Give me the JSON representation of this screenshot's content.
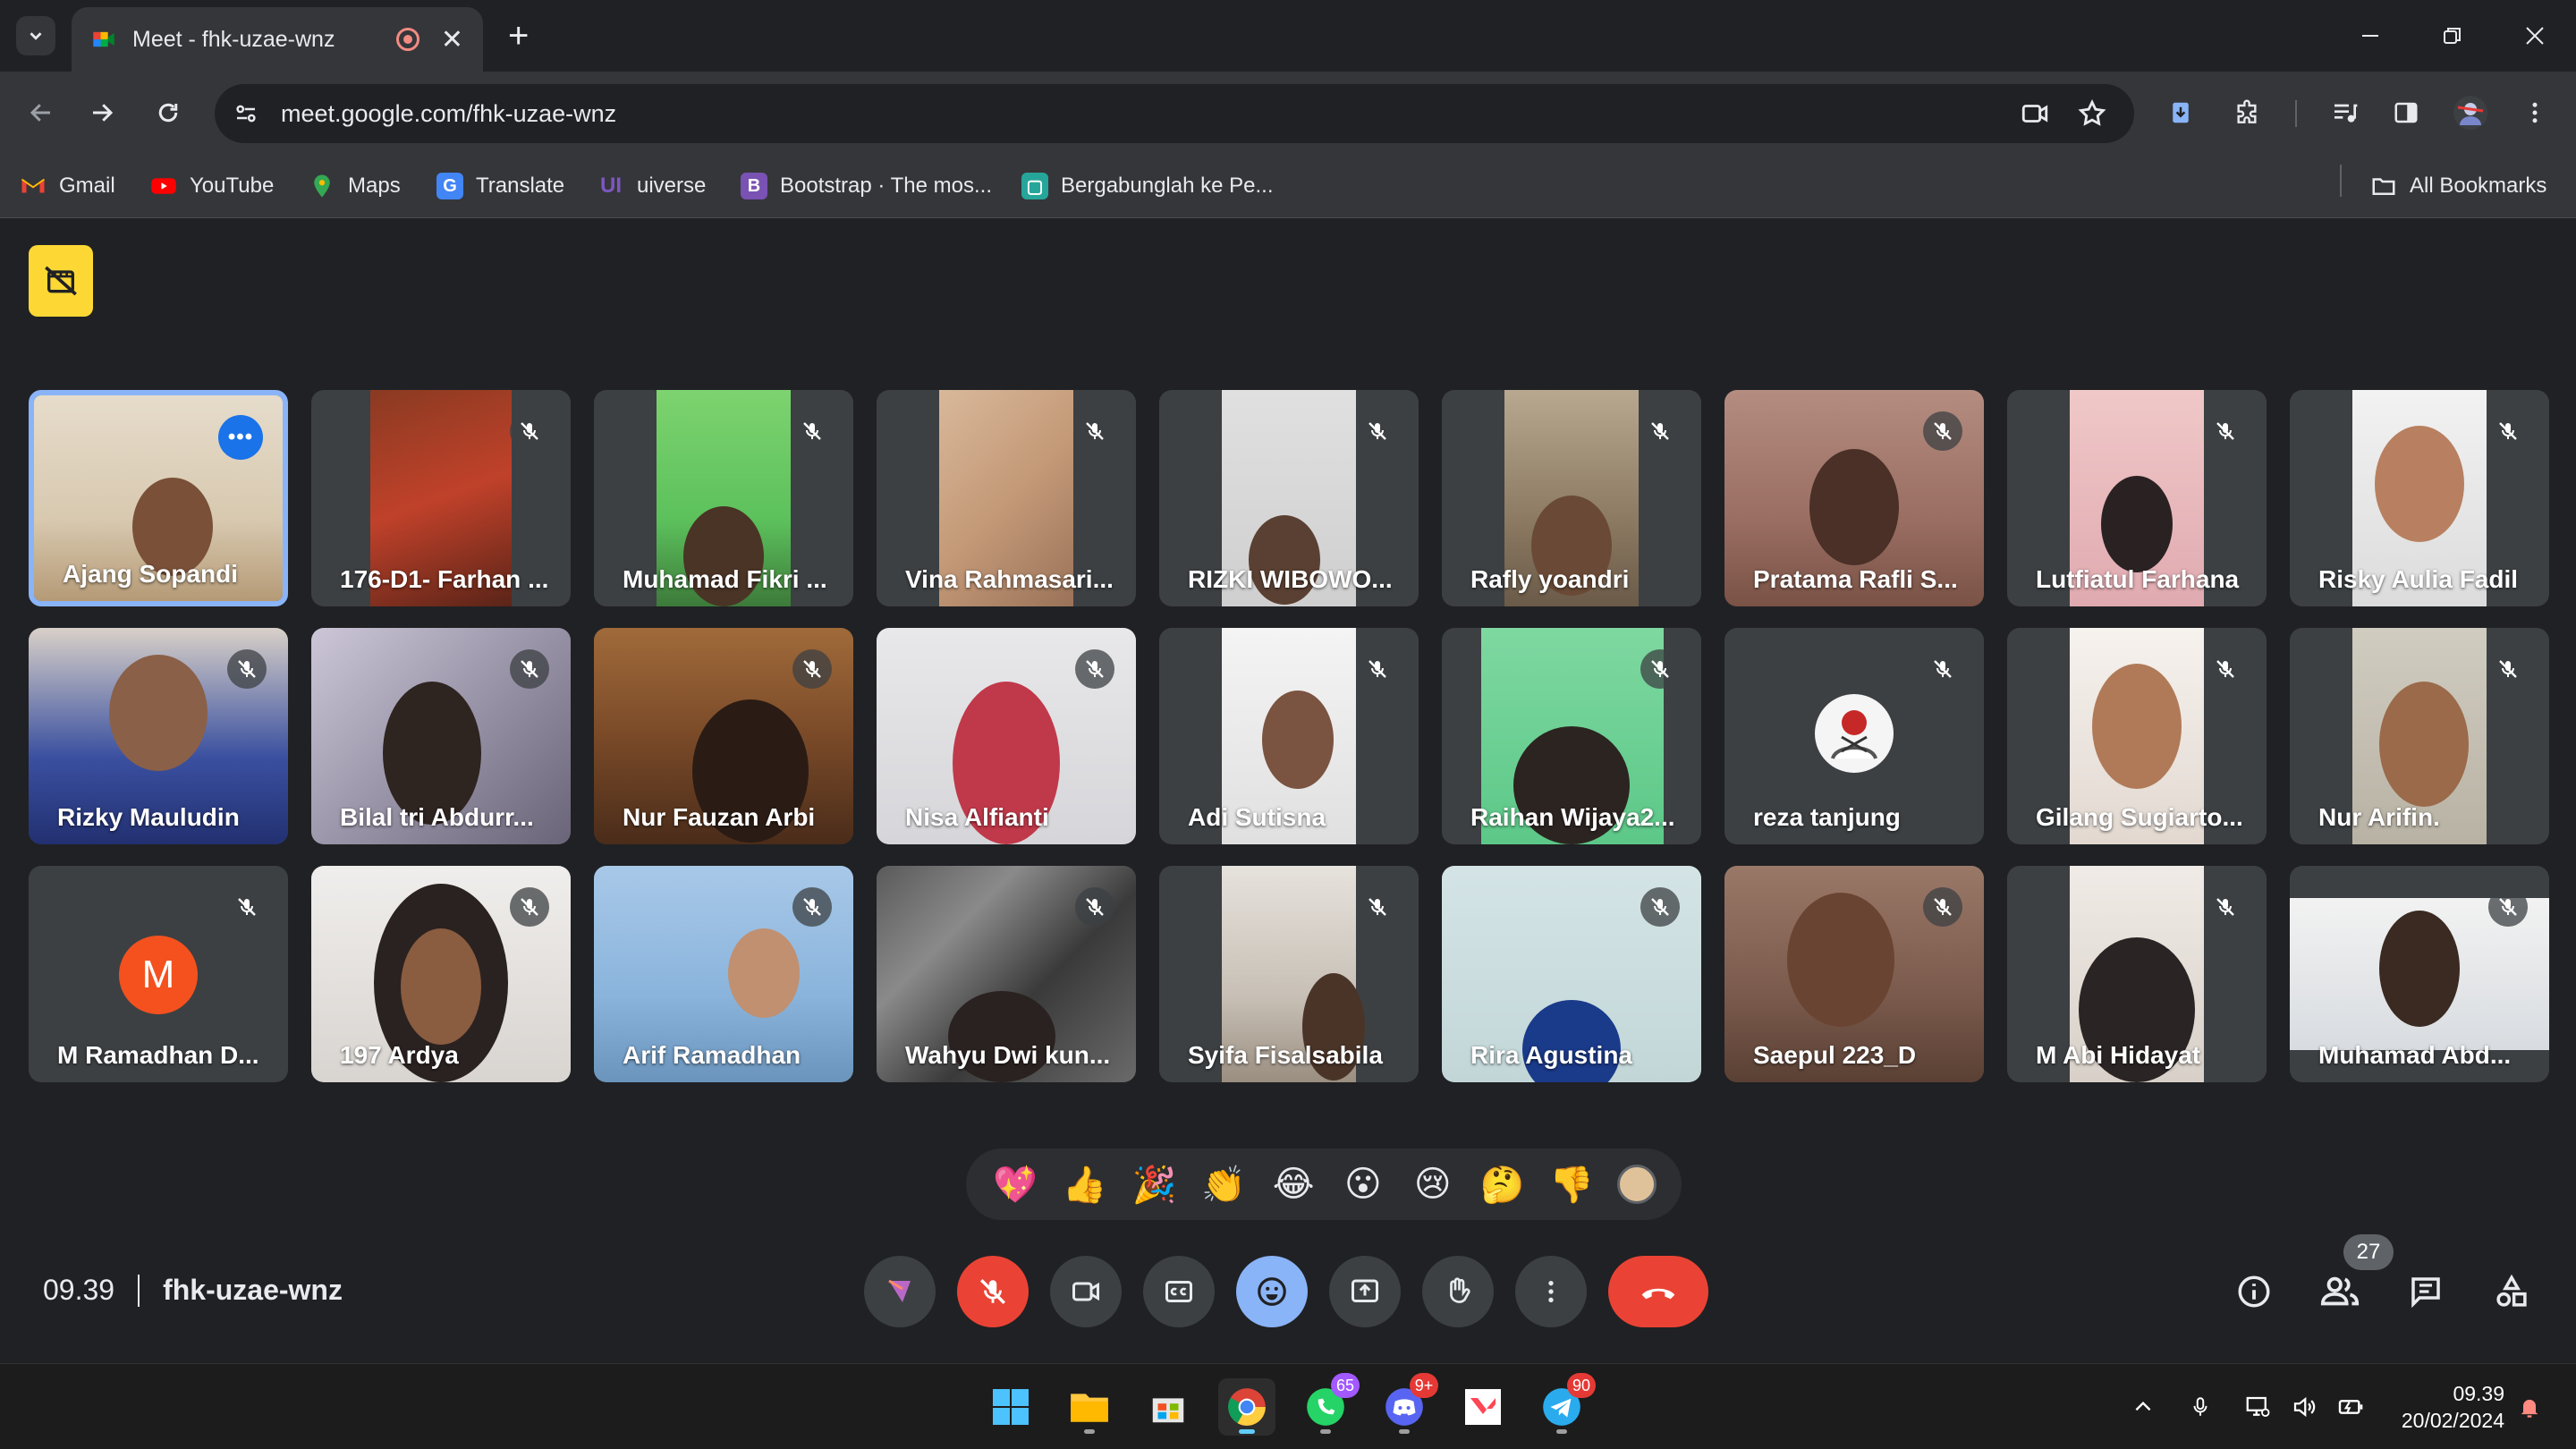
{
  "browser": {
    "tab_title": "Meet - fhk-uzae-wnz",
    "url": "meet.google.com/fhk-uzae-wnz",
    "new_tab": "+",
    "bookmarks": [
      {
        "label": "Gmail",
        "icon": "gmail-icon",
        "color": "#ea4335"
      },
      {
        "label": "YouTube",
        "icon": "youtube-icon",
        "color": "#ff0000"
      },
      {
        "label": "Maps",
        "icon": "maps-icon",
        "color": "#34a853"
      },
      {
        "label": "Translate",
        "icon": "translate-icon",
        "color": "#4285f4"
      },
      {
        "label": "uiverse",
        "icon": "uiverse-icon",
        "color": "#7e57c2"
      },
      {
        "label": "Bootstrap · The mos...",
        "icon": "bootstrap-icon",
        "color": "#7952b3"
      },
      {
        "label": "Bergabunglah ke Pe...",
        "icon": "classroom-icon",
        "color": "#26a69a"
      }
    ],
    "all_bookmarks": "All Bookmarks"
  },
  "meet": {
    "participants": [
      {
        "name": "Ajang Sopandi",
        "active": true
      },
      {
        "name": "176-D1- Farhan ..."
      },
      {
        "name": "Muhamad Fikri ..."
      },
      {
        "name": "Vina Rahmasari..."
      },
      {
        "name": "RIZKI WIBOWO..."
      },
      {
        "name": "Rafly yoandri"
      },
      {
        "name": "Pratama Rafli S..."
      },
      {
        "name": "Lutfiatul Farhana"
      },
      {
        "name": "Risky Aulia Fadil"
      },
      {
        "name": "Rizky Mauludin"
      },
      {
        "name": "Bilal tri Abdurr..."
      },
      {
        "name": "Nur Fauzan Arbi"
      },
      {
        "name": "Nisa Alfianti"
      },
      {
        "name": "Adi Sutisna"
      },
      {
        "name": "Raihan Wijaya2..."
      },
      {
        "name": "reza tanjung"
      },
      {
        "name": "Gilang Sugiarto..."
      },
      {
        "name": "Nur Arifin."
      },
      {
        "name": "M Ramadhan D...",
        "initial": "M"
      },
      {
        "name": "197 Ardya"
      },
      {
        "name": "Arif Ramadhan"
      },
      {
        "name": "Wahyu Dwi kun..."
      },
      {
        "name": "Syifa Fisalsabila"
      },
      {
        "name": "Rira Agustina"
      },
      {
        "name": "Saepul 223_D"
      },
      {
        "name": "M Abi Hidayat"
      },
      {
        "name": "Muhamad Abd..."
      }
    ],
    "more_options": "•••",
    "reactions": [
      "💖",
      "👍",
      "🎉",
      "👏",
      "😂",
      "😮",
      "😢",
      "🤔",
      "👎"
    ],
    "time": "09.39",
    "meeting_code": "fhk-uzae-wnz",
    "participant_count": "27"
  },
  "taskbar": {
    "whatsapp_badge": "65",
    "discord_badge": "9+",
    "telegram_badge": "90",
    "clock_time": "09.39",
    "clock_date": "20/02/2024"
  }
}
